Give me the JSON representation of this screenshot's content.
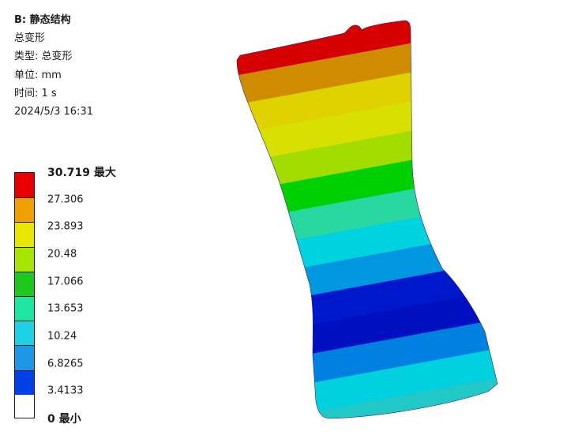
{
  "info": {
    "title": "B: 静态结构",
    "result_name": "总变形",
    "type_line": "类型: 总变形",
    "unit_line": "单位: mm",
    "time_line": "时间: 1 s",
    "timestamp": "2024/5/3 16:31"
  },
  "legend": {
    "labels": [
      "30.719 最大",
      "27.306",
      "23.893",
      "20.48",
      "17.066",
      "13.653",
      "10.24",
      "6.8265",
      "3.4133",
      "0 最小"
    ],
    "colors": [
      "#e60000",
      "#f0a000",
      "#e6e600",
      "#a6e600",
      "#1ec81e",
      "#1ee6a0",
      "#1ed2e6",
      "#1e96e6",
      "#0040e6"
    ]
  },
  "model_band_colors": [
    "#d60000",
    "#d08c00",
    "#e0d200",
    "#d8e000",
    "#a2dc00",
    "#00d000",
    "#28d8a0",
    "#00d2e0",
    "#0096e0",
    "#0018cc",
    "#0010c0",
    "#0080e0",
    "#00d0e0",
    "#20c8c8"
  ]
}
